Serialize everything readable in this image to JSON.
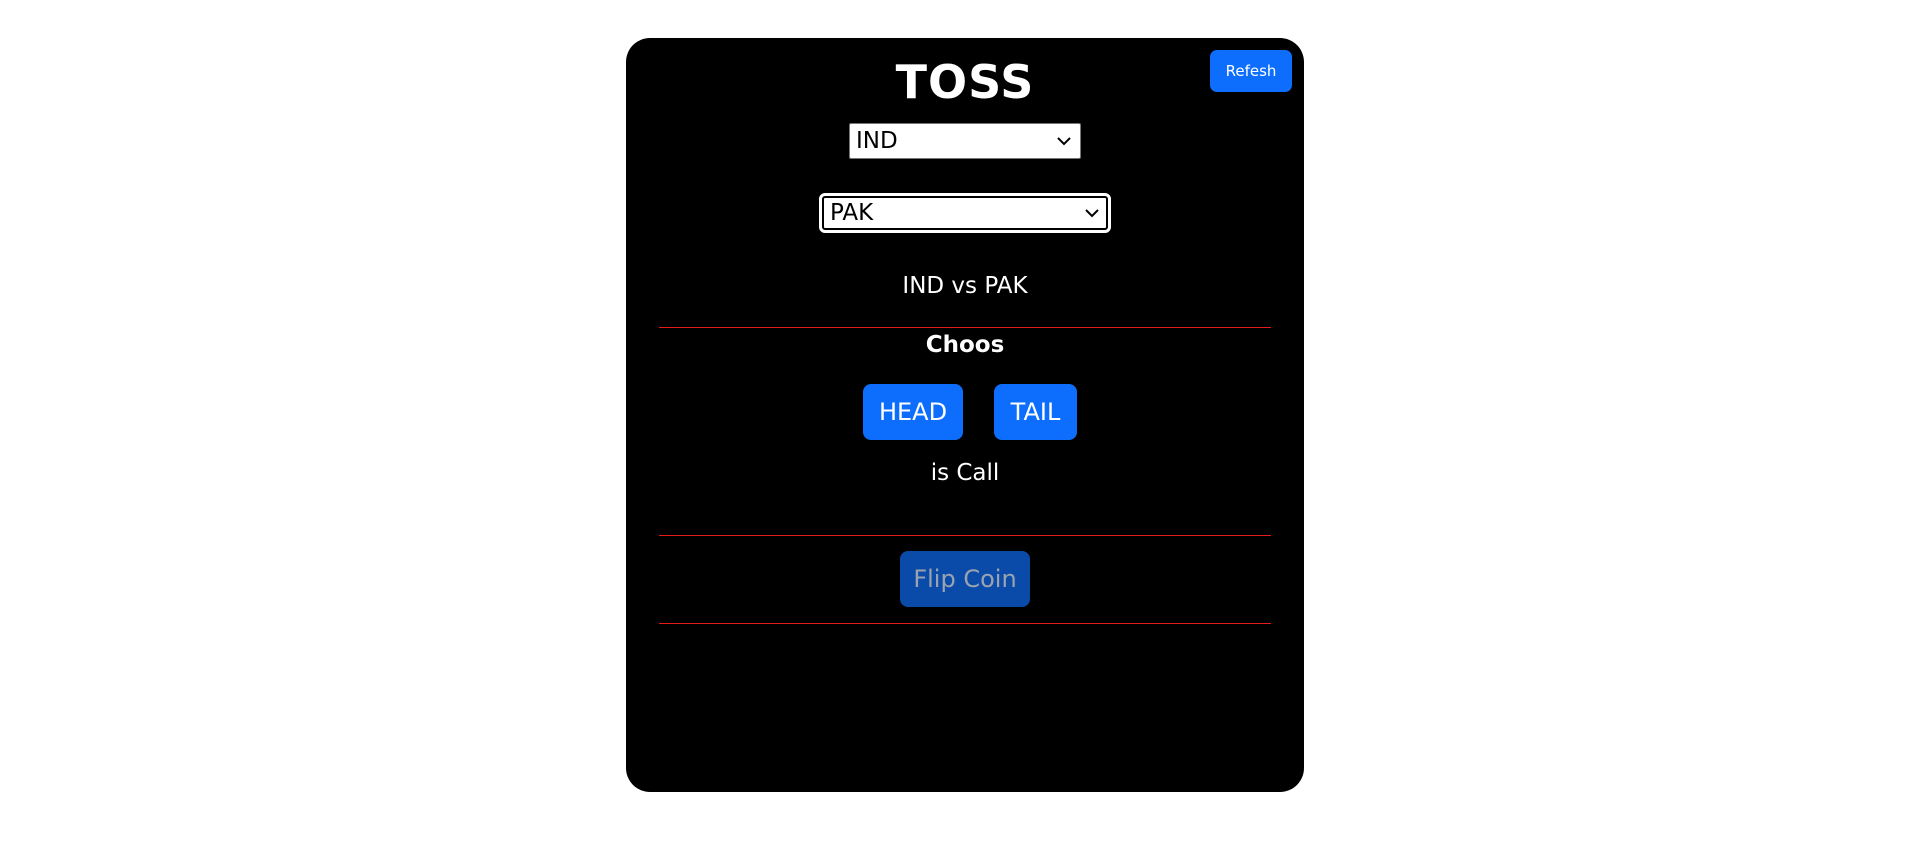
{
  "header": {
    "title": "TOSS",
    "refresh_label": "Refesh"
  },
  "teams": {
    "team_a_selected": "IND",
    "team_b_selected": "PAK"
  },
  "match": {
    "label": "IND vs PAK"
  },
  "choice": {
    "heading": "Choos",
    "head_label": "HEAD",
    "tail_label": "TAIL",
    "call_text": "is Call"
  },
  "actions": {
    "flip_label": "Flip Coin"
  },
  "colors": {
    "card_bg": "#000000",
    "primary_button": "#0d6efd",
    "disabled_button": "#0a4aa8",
    "divider": "#e31b1b"
  }
}
